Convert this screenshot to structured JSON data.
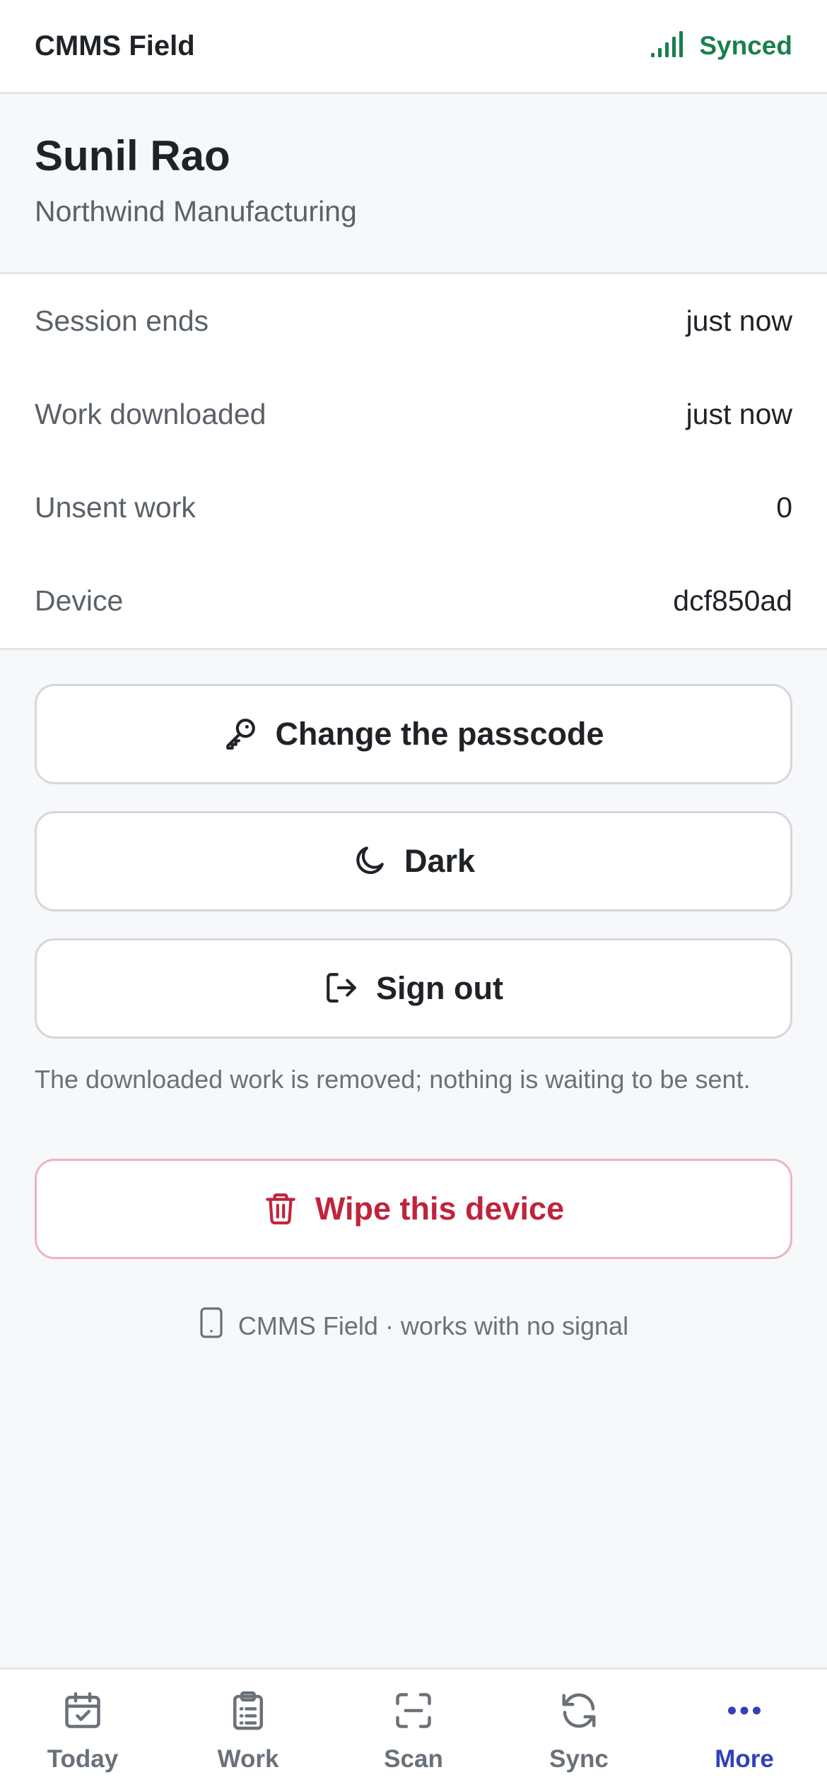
{
  "header": {
    "title": "CMMS Field",
    "sync_status": "Synced",
    "sync_icon": "signal-bars-icon"
  },
  "profile": {
    "name": "Sunil Rao",
    "organization": "Northwind Manufacturing"
  },
  "info_rows": [
    {
      "label": "Session ends",
      "value": "just now"
    },
    {
      "label": "Work downloaded",
      "value": "just now"
    },
    {
      "label": "Unsent work",
      "value": "0"
    },
    {
      "label": "Device",
      "value": "dcf850ad"
    }
  ],
  "actions": {
    "change_passcode": "Change the passcode",
    "theme": "Dark",
    "sign_out": "Sign out",
    "sign_out_note": "The downloaded work is removed; nothing is waiting to be sent.",
    "wipe": "Wipe this device"
  },
  "footer": {
    "text": "CMMS Field · works with no signal"
  },
  "tabs": [
    {
      "label": "Today",
      "icon": "calendar-check-icon"
    },
    {
      "label": "Work",
      "icon": "clipboard-list-icon"
    },
    {
      "label": "Scan",
      "icon": "scan-icon"
    },
    {
      "label": "Sync",
      "icon": "refresh-icon"
    },
    {
      "label": "More",
      "icon": "more-dots-icon",
      "active": true
    }
  ],
  "colors": {
    "synced": "#1a7f4e",
    "danger": "#c0243c",
    "active_tab": "#3340b8"
  }
}
